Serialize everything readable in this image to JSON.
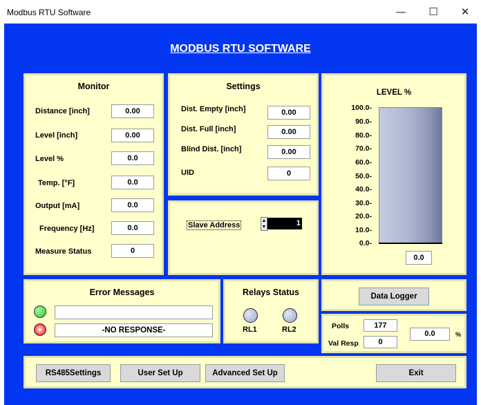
{
  "window": {
    "title": "Modbus RTU Software",
    "minimize": "—",
    "maximize": "☐",
    "close": "✕"
  },
  "header": {
    "title": "MODBUS RTU SOFTWARE"
  },
  "monitor": {
    "title": "Monitor",
    "rows": [
      {
        "label": "Distance [inch]",
        "value": "0.00"
      },
      {
        "label": "Level [inch]",
        "value": "0.00"
      },
      {
        "label": "Level %",
        "value": "0.0"
      },
      {
        "label": "Temp. [°F]",
        "value": "0.0"
      },
      {
        "label": "Output [mA]",
        "value": "0.0"
      },
      {
        "label": "Frequency [Hz]",
        "value": "0.0"
      },
      {
        "label": "Measure Status",
        "value": "0"
      }
    ]
  },
  "settings": {
    "title": "Settings",
    "rows": [
      {
        "label": "Dist. Empty [inch]",
        "value": "0.00"
      },
      {
        "label": "Dist. Full [inch]",
        "value": "0.00"
      },
      {
        "label": "Blind Dist. [inch]",
        "value": "0.00"
      },
      {
        "label": "UID",
        "value": "0"
      }
    ]
  },
  "slave": {
    "label": "Slave Address",
    "value": "1"
  },
  "level": {
    "title": "LEVEL %",
    "ticks": [
      "100.0-",
      "90.0-",
      "80.0-",
      "70.0-",
      "60.0-",
      "50.0-",
      "40.0-",
      "30.0-",
      "20.0-",
      "10.0-",
      "0.0-"
    ],
    "value": "0.0",
    "fill_percent": 0
  },
  "errors": {
    "title": "Error Messages",
    "message1": "",
    "message2": "-NO RESPONSE-",
    "led_ok_color": "#22cc22",
    "led_err_color": "#ee2222"
  },
  "relays": {
    "title": "Relays Status",
    "rl1": "RL1",
    "rl2": "RL2"
  },
  "datalogger": {
    "label": "Data Logger"
  },
  "stats": {
    "polls_label": "Polls",
    "polls_value": "177",
    "valresp_label": "Val Resp",
    "valresp_value": "0",
    "percent_value": "0.0",
    "percent_unit": "%"
  },
  "buttons": {
    "rs485": "RS485Settings",
    "user": "User Set Up",
    "advanced": "Advanced Set Up",
    "exit": "Exit"
  },
  "colors": {
    "background": "#0336f0",
    "panel": "#ffffcc"
  }
}
